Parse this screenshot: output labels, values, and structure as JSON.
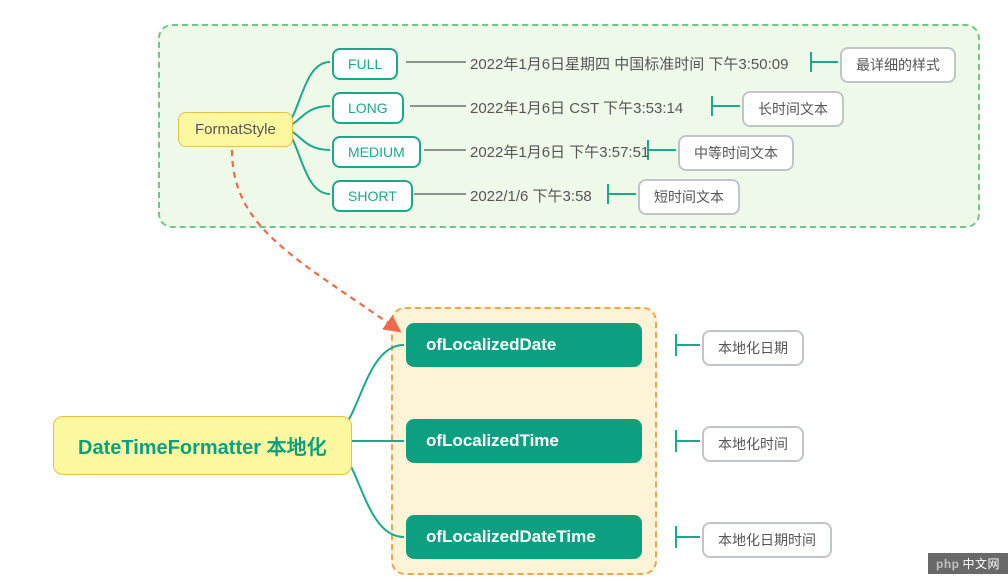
{
  "top": {
    "root_label": "FormatStyle",
    "items": [
      {
        "key": "FULL",
        "example": "2022年1月6日星期四 中国标准时间 下午3:50:09",
        "desc": "最详细的样式"
      },
      {
        "key": "LONG",
        "example": "2022年1月6日 CST 下午3:53:14",
        "desc": "长时间文本"
      },
      {
        "key": "MEDIUM",
        "example": "2022年1月6日 下午3:57:51",
        "desc": "中等时间文本"
      },
      {
        "key": "SHORT",
        "example": "2022/1/6 下午3:58",
        "desc": "短时间文本"
      }
    ]
  },
  "bottom": {
    "root_label": "DateTimeFormatter 本地化",
    "items": [
      {
        "method": "ofLocalizedDate",
        "desc": "本地化日期"
      },
      {
        "method": "ofLocalizedTime",
        "desc": "本地化时间"
      },
      {
        "method": "ofLocalizedDateTime",
        "desc": "本地化日期时间"
      }
    ]
  },
  "watermark": {
    "brand": "php",
    "text": "中文网"
  }
}
